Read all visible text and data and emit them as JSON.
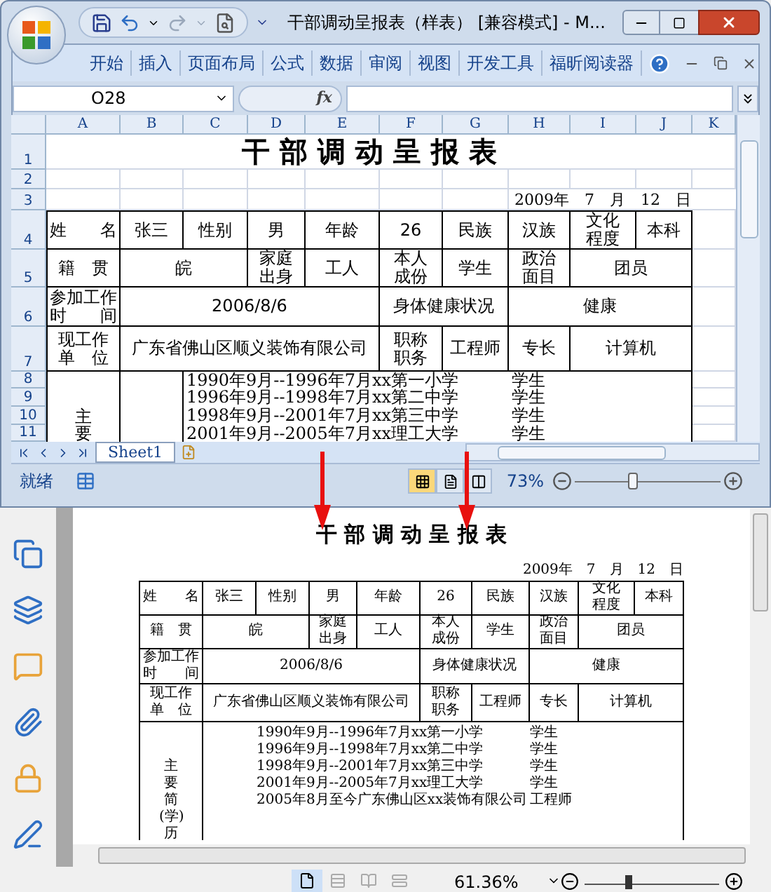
{
  "excel": {
    "title": "干部调动呈报表（样表） [兼容模式] - M...",
    "ribbon_tabs": [
      "开始",
      "插入",
      "页面布局",
      "公式",
      "数据",
      "审阅",
      "视图",
      "开发工具",
      "福昕阅读器"
    ],
    "name_box": "O28",
    "function_label": "fx",
    "columns": [
      "A",
      "B",
      "C",
      "D",
      "E",
      "F",
      "G",
      "H",
      "I",
      "J",
      "K"
    ],
    "row_numbers": [
      "1",
      "2",
      "3",
      "4",
      "5",
      "6",
      "7",
      "8",
      "9",
      "10",
      "11"
    ],
    "form": {
      "title": "干 部 调 动 呈 报 表",
      "date": "2009年　7　月　12　日",
      "rows": [
        [
          {
            "text": "姓　　名"
          },
          {
            "text": "张三"
          },
          {
            "text": "性别"
          },
          {
            "text": "男"
          },
          {
            "text": "年龄"
          },
          {
            "text": "26"
          },
          {
            "text": "民族"
          },
          {
            "text": "汉族"
          },
          {
            "text": "文化程度"
          },
          {
            "text": "本科"
          }
        ],
        [
          {
            "text": "籍　贯"
          },
          {
            "text": "皖",
            "colspan": 2
          },
          {
            "text": "家庭出身"
          },
          {
            "text": "工人"
          },
          {
            "text": "本人成份"
          },
          {
            "text": "学生"
          },
          {
            "text": "政治面目"
          },
          {
            "text": "团员",
            "colspan": 2
          }
        ],
        [
          {
            "text": "参加工作时间"
          },
          {
            "text": "2006/8/6",
            "colspan": 4
          },
          {
            "text": "身体健康状况",
            "colspan": 2
          },
          {
            "text": "健康",
            "colspan": 3
          }
        ],
        [
          {
            "text": "现工作单位"
          },
          {
            "text": "广东省佛山区顺义装饰有限公司",
            "colspan": 4
          },
          {
            "text": "职称职务"
          },
          {
            "text": "工程师"
          },
          {
            "text": "专长"
          },
          {
            "text": "计算机",
            "colspan": 2
          }
        ]
      ]
    },
    "history_rows": [
      {
        "entry": "1990年9月--1996年7月xx第一小学",
        "role": "学生"
      },
      {
        "entry": "1996年9月--1998年7月xx第二中学",
        "role": "学生"
      },
      {
        "label": "主",
        "entry": "1998年9月--2001年7月xx第三中学",
        "role": "学生"
      },
      {
        "label": "要",
        "entry": "2001年9月--2005年7月xx理工大学",
        "role": "学生"
      }
    ],
    "sheet_tabs": [
      {
        "label": "Sheet1",
        "selected": true
      }
    ],
    "status": "就绪",
    "view_buttons": [
      {
        "kind": "normal",
        "selected": true
      },
      {
        "kind": "layout",
        "selected": false
      },
      {
        "kind": "break",
        "selected": false
      }
    ],
    "zoom": {
      "reading": "73%",
      "level": 0.37
    }
  },
  "pdf": {
    "form": {
      "title": "干 部 调 动 呈 报 表",
      "date": "2009年　7　月　12　日",
      "rows": [
        [
          {
            "text": "姓　　名"
          },
          {
            "text": "张三"
          },
          {
            "text": "性别"
          },
          {
            "text": "男"
          },
          {
            "text": "年龄"
          },
          {
            "text": "26"
          },
          {
            "text": "民族"
          },
          {
            "text": "汉族"
          },
          {
            "text": "文化程度"
          },
          {
            "text": "本科"
          }
        ],
        [
          {
            "text": "籍　贯"
          },
          {
            "text": "皖",
            "colspan": 2
          },
          {
            "text": "家庭出身"
          },
          {
            "text": "工人"
          },
          {
            "text": "本人成份"
          },
          {
            "text": "学生"
          },
          {
            "text": "政治面目"
          },
          {
            "text": "团员",
            "colspan": 2
          }
        ],
        [
          {
            "text": "参加工作时间"
          },
          {
            "text": "2006/8/6",
            "colspan": 4
          },
          {
            "text": "身体健康状况",
            "colspan": 2
          },
          {
            "text": "健康",
            "colspan": 3
          }
        ],
        [
          {
            "text": "现工作单位"
          },
          {
            "text": "广东省佛山区顺义装饰有限公司",
            "colspan": 4
          },
          {
            "text": "职称职务"
          },
          {
            "text": "工程师"
          },
          {
            "text": "专长"
          },
          {
            "text": "计算机",
            "colspan": 2
          }
        ]
      ]
    },
    "history": {
      "label": "主要简(学)历",
      "entries": [
        {
          "entry": "1990年9月--1996年7月xx第一小学",
          "role": "学生"
        },
        {
          "entry": "1996年9月--1998年7月xx第二中学",
          "role": "学生"
        },
        {
          "entry": "1998年9月--2001年7月xx第三中学",
          "role": "学生"
        },
        {
          "entry": "2001年9月--2005年7月xx理工大学",
          "role": "学生"
        },
        {
          "entry": "2005年8月至今广东佛山区xx装饰有限公司",
          "role": "工程师"
        }
      ]
    },
    "view_buttons": [
      {
        "kind": "single",
        "selected": true
      },
      {
        "kind": "continuous",
        "selected": false
      },
      {
        "kind": "facing",
        "selected": false
      },
      {
        "kind": "cover",
        "selected": false
      }
    ],
    "zoom": {
      "reading": "61.36%",
      "level": 0.3
    }
  }
}
